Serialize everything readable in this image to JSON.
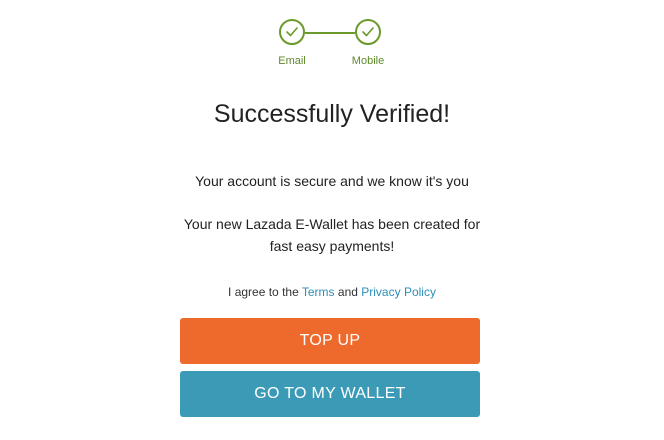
{
  "stepper": {
    "steps": [
      {
        "label": "Email",
        "completed": true
      },
      {
        "label": "Mobile",
        "completed": true
      }
    ],
    "color": "#6a9a2a",
    "icon": "check-icon"
  },
  "title": "Successfully Verified!",
  "messages": {
    "secure": "Your account is secure and we know it's you",
    "wallet_line1": "Your new Lazada E-Wallet has been created for",
    "wallet_line2": "fast easy payments!"
  },
  "agreement": {
    "prefix": "I agree to the",
    "terms_link": "Terms",
    "conjunction": "and",
    "privacy_link": "Privacy Policy",
    "link_color": "#2a8fb8"
  },
  "buttons": {
    "top_up": "TOP UP",
    "go_to_wallet": "GO TO MY WALLET"
  },
  "colors": {
    "top_up": "#ee6a2c",
    "wallet": "#3b9bb6"
  }
}
